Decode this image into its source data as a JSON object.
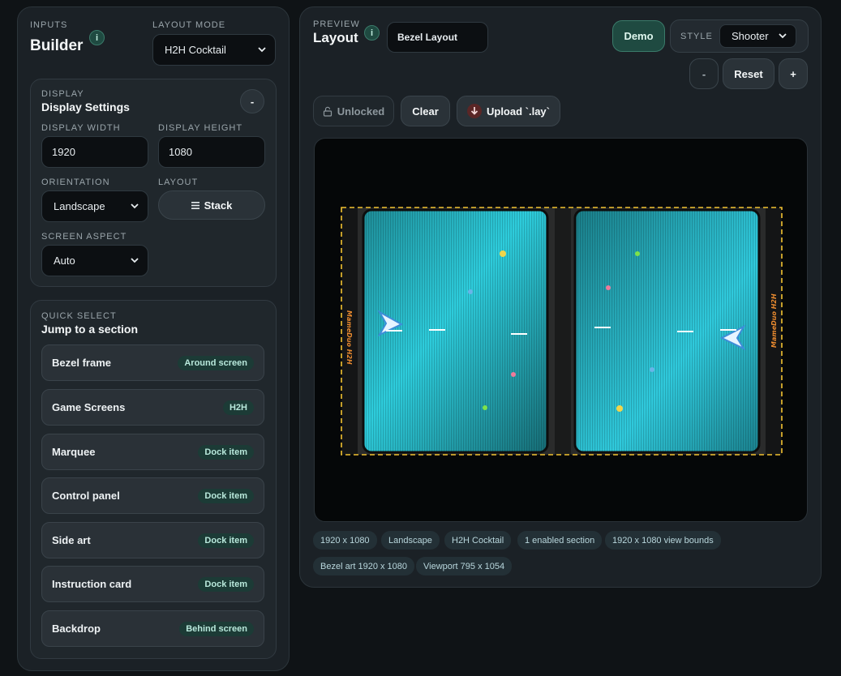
{
  "inputs": {
    "eyebrow": "INPUTS",
    "title": "Builder",
    "info_glyph": "i",
    "layout_mode_label": "LAYOUT MODE",
    "layout_mode_value": "H2H Cocktail"
  },
  "display": {
    "eyebrow": "DISPLAY",
    "title": "Display Settings",
    "collapse_label": "-",
    "width_label": "DISPLAY WIDTH",
    "width_value": "1920",
    "height_label": "DISPLAY HEIGHT",
    "height_value": "1080",
    "orientation_label": "ORIENTATION",
    "orientation_value": "Landscape",
    "layout_label": "LAYOUT",
    "layout_button": "Stack",
    "aspect_label": "SCREEN ASPECT",
    "aspect_value": "Auto"
  },
  "quick_select": {
    "eyebrow": "QUICK SELECT",
    "title": "Jump to a section",
    "items": [
      {
        "label": "Bezel frame",
        "badge": "Around screen"
      },
      {
        "label": "Game Screens",
        "badge": "H2H"
      },
      {
        "label": "Marquee",
        "badge": "Dock item"
      },
      {
        "label": "Control panel",
        "badge": "Dock item"
      },
      {
        "label": "Side art",
        "badge": "Dock item"
      },
      {
        "label": "Instruction card",
        "badge": "Dock item"
      },
      {
        "label": "Backdrop",
        "badge": "Behind screen"
      }
    ]
  },
  "preview": {
    "eyebrow": "PREVIEW",
    "title": "Layout",
    "info_glyph": "i",
    "name_value": "Bezel Layout",
    "demo_button": "Demo",
    "style_label": "STYLE",
    "style_value": "Shooter",
    "zoom_out": "-",
    "reset": "Reset",
    "zoom_in": "+",
    "lock_button": "Unlocked",
    "clear_button": "Clear",
    "upload_button": "Upload `.lay`",
    "side_logo_text": "MameDuo H2H"
  },
  "chips": [
    "1920 x 1080",
    "Landscape",
    "H2H Cocktail",
    "1 enabled section",
    "1920 x 1080 view bounds",
    "Bezel art 1920 x 1080",
    "Viewport 795 x 1054"
  ],
  "colors": {
    "accent": "#1f4a41",
    "selection_outline": "#f2c230",
    "screen_cyan": "#2bc6d6"
  }
}
